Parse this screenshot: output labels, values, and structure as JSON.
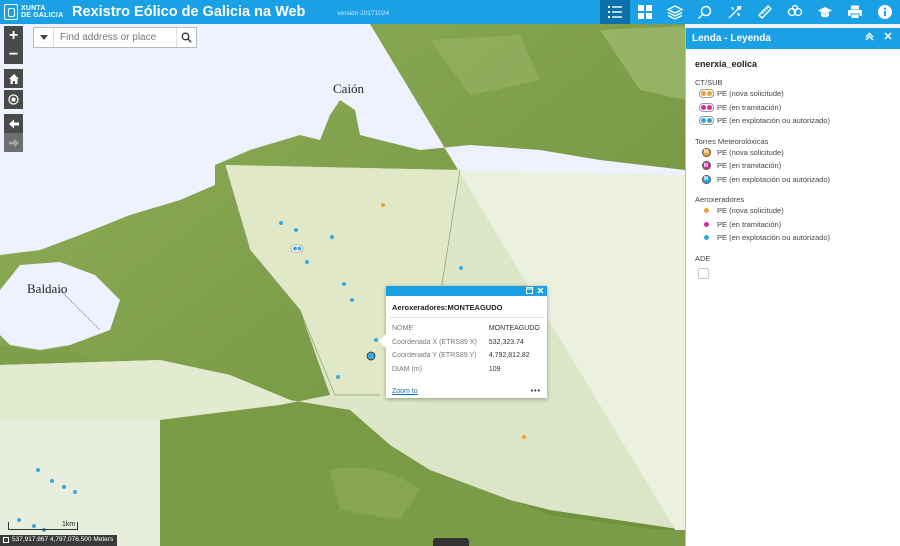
{
  "header": {
    "logo_line1": "XUNTA",
    "logo_line2": "DE GALICIA",
    "title": "Rexistro Eólico de Galicia na Web",
    "version": "versión 20171024"
  },
  "toolbar": {
    "items": [
      {
        "icon": "legend-list-icon",
        "active": true
      },
      {
        "icon": "basemap-gallery-icon",
        "active": false
      },
      {
        "icon": "layer-list-icon",
        "active": false
      },
      {
        "icon": "query-icon",
        "active": false
      },
      {
        "icon": "coordinate-icon",
        "active": false
      },
      {
        "icon": "measure-ruler-icon",
        "active": false
      },
      {
        "icon": "analysis-icon",
        "active": false
      },
      {
        "icon": "about-cap-icon",
        "active": false
      },
      {
        "icon": "print-icon",
        "active": false
      },
      {
        "icon": "info-icon",
        "active": false
      }
    ]
  },
  "map": {
    "zoom_in": "+",
    "zoom_out": "−",
    "places": [
      "Caión",
      "Baldaio"
    ],
    "search_placeholder": "Find address or place",
    "scale_label": "1km",
    "coordinates": "537,917.867 4,797,076.500 Meters"
  },
  "popup": {
    "title": "Aeroxeradores:MONTEAGUDO",
    "rows": [
      {
        "label": "NOME",
        "value": "MONTEAGUDO"
      },
      {
        "label": "Coordenada X (ETRS89 X)",
        "value": "532,323.74"
      },
      {
        "label": "Coordenada Y (ETRS89 Y)",
        "value": "4,792,812.82"
      },
      {
        "label": "DIAM (m)",
        "value": "109"
      }
    ],
    "zoom_to": "Zoom to",
    "more": "•••"
  },
  "legend": {
    "title": "Lenda - Leyenda",
    "layer": "enerxia_eolica",
    "groups": [
      {
        "name": "CT/SUB",
        "items": [
          {
            "label": "PE (nova solicitude)",
            "color": "#f0a030"
          },
          {
            "label": "PE (en tramitación)",
            "color": "#d12fa3"
          },
          {
            "label": "PE (en explotación ou autorizado)",
            "color": "#2aa8e0"
          }
        ]
      },
      {
        "name": "Torres Meteorolóxicas",
        "items": [
          {
            "label": "PE (nova solicitude)",
            "color": "#f0a030"
          },
          {
            "label": "PE (en tramitación)",
            "color": "#d12fa3"
          },
          {
            "label": "PE (en explotación ou autorizado)",
            "color": "#2aa8e0"
          }
        ]
      },
      {
        "name": "Aeroxeradores",
        "items": [
          {
            "label": "PE (nova solicitude)",
            "color": "#f0a030"
          },
          {
            "label": "PE (en tramitación)",
            "color": "#d12fa3"
          },
          {
            "label": "PE (en explotación ou autorizado)",
            "color": "#2aa8e0"
          }
        ]
      }
    ],
    "ade_label": "ADE",
    "tower_letter": "M"
  },
  "colors": {
    "brand": "#1aa0e4",
    "land": "#7d9e4a",
    "sea": "#eef2ff"
  }
}
